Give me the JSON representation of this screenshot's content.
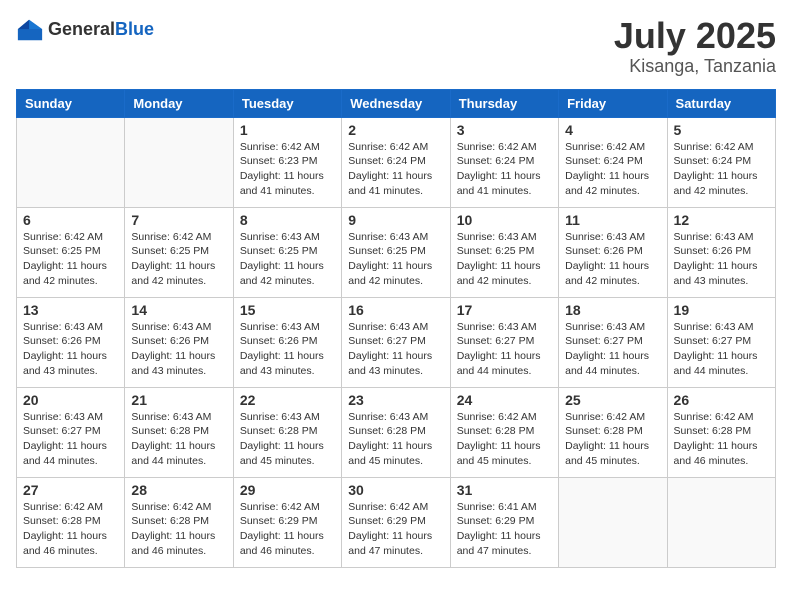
{
  "logo": {
    "general": "General",
    "blue": "Blue"
  },
  "title": {
    "month": "July 2025",
    "location": "Kisanga, Tanzania"
  },
  "weekdays": [
    "Sunday",
    "Monday",
    "Tuesday",
    "Wednesday",
    "Thursday",
    "Friday",
    "Saturday"
  ],
  "weeks": [
    [
      {
        "day": "",
        "sunrise": "",
        "sunset": "",
        "daylight": ""
      },
      {
        "day": "",
        "sunrise": "",
        "sunset": "",
        "daylight": ""
      },
      {
        "day": "1",
        "sunrise": "Sunrise: 6:42 AM",
        "sunset": "Sunset: 6:23 PM",
        "daylight": "Daylight: 11 hours and 41 minutes."
      },
      {
        "day": "2",
        "sunrise": "Sunrise: 6:42 AM",
        "sunset": "Sunset: 6:24 PM",
        "daylight": "Daylight: 11 hours and 41 minutes."
      },
      {
        "day": "3",
        "sunrise": "Sunrise: 6:42 AM",
        "sunset": "Sunset: 6:24 PM",
        "daylight": "Daylight: 11 hours and 41 minutes."
      },
      {
        "day": "4",
        "sunrise": "Sunrise: 6:42 AM",
        "sunset": "Sunset: 6:24 PM",
        "daylight": "Daylight: 11 hours and 42 minutes."
      },
      {
        "day": "5",
        "sunrise": "Sunrise: 6:42 AM",
        "sunset": "Sunset: 6:24 PM",
        "daylight": "Daylight: 11 hours and 42 minutes."
      }
    ],
    [
      {
        "day": "6",
        "sunrise": "Sunrise: 6:42 AM",
        "sunset": "Sunset: 6:25 PM",
        "daylight": "Daylight: 11 hours and 42 minutes."
      },
      {
        "day": "7",
        "sunrise": "Sunrise: 6:42 AM",
        "sunset": "Sunset: 6:25 PM",
        "daylight": "Daylight: 11 hours and 42 minutes."
      },
      {
        "day": "8",
        "sunrise": "Sunrise: 6:43 AM",
        "sunset": "Sunset: 6:25 PM",
        "daylight": "Daylight: 11 hours and 42 minutes."
      },
      {
        "day": "9",
        "sunrise": "Sunrise: 6:43 AM",
        "sunset": "Sunset: 6:25 PM",
        "daylight": "Daylight: 11 hours and 42 minutes."
      },
      {
        "day": "10",
        "sunrise": "Sunrise: 6:43 AM",
        "sunset": "Sunset: 6:25 PM",
        "daylight": "Daylight: 11 hours and 42 minutes."
      },
      {
        "day": "11",
        "sunrise": "Sunrise: 6:43 AM",
        "sunset": "Sunset: 6:26 PM",
        "daylight": "Daylight: 11 hours and 42 minutes."
      },
      {
        "day": "12",
        "sunrise": "Sunrise: 6:43 AM",
        "sunset": "Sunset: 6:26 PM",
        "daylight": "Daylight: 11 hours and 43 minutes."
      }
    ],
    [
      {
        "day": "13",
        "sunrise": "Sunrise: 6:43 AM",
        "sunset": "Sunset: 6:26 PM",
        "daylight": "Daylight: 11 hours and 43 minutes."
      },
      {
        "day": "14",
        "sunrise": "Sunrise: 6:43 AM",
        "sunset": "Sunset: 6:26 PM",
        "daylight": "Daylight: 11 hours and 43 minutes."
      },
      {
        "day": "15",
        "sunrise": "Sunrise: 6:43 AM",
        "sunset": "Sunset: 6:26 PM",
        "daylight": "Daylight: 11 hours and 43 minutes."
      },
      {
        "day": "16",
        "sunrise": "Sunrise: 6:43 AM",
        "sunset": "Sunset: 6:27 PM",
        "daylight": "Daylight: 11 hours and 43 minutes."
      },
      {
        "day": "17",
        "sunrise": "Sunrise: 6:43 AM",
        "sunset": "Sunset: 6:27 PM",
        "daylight": "Daylight: 11 hours and 44 minutes."
      },
      {
        "day": "18",
        "sunrise": "Sunrise: 6:43 AM",
        "sunset": "Sunset: 6:27 PM",
        "daylight": "Daylight: 11 hours and 44 minutes."
      },
      {
        "day": "19",
        "sunrise": "Sunrise: 6:43 AM",
        "sunset": "Sunset: 6:27 PM",
        "daylight": "Daylight: 11 hours and 44 minutes."
      }
    ],
    [
      {
        "day": "20",
        "sunrise": "Sunrise: 6:43 AM",
        "sunset": "Sunset: 6:27 PM",
        "daylight": "Daylight: 11 hours and 44 minutes."
      },
      {
        "day": "21",
        "sunrise": "Sunrise: 6:43 AM",
        "sunset": "Sunset: 6:28 PM",
        "daylight": "Daylight: 11 hours and 44 minutes."
      },
      {
        "day": "22",
        "sunrise": "Sunrise: 6:43 AM",
        "sunset": "Sunset: 6:28 PM",
        "daylight": "Daylight: 11 hours and 45 minutes."
      },
      {
        "day": "23",
        "sunrise": "Sunrise: 6:43 AM",
        "sunset": "Sunset: 6:28 PM",
        "daylight": "Daylight: 11 hours and 45 minutes."
      },
      {
        "day": "24",
        "sunrise": "Sunrise: 6:42 AM",
        "sunset": "Sunset: 6:28 PM",
        "daylight": "Daylight: 11 hours and 45 minutes."
      },
      {
        "day": "25",
        "sunrise": "Sunrise: 6:42 AM",
        "sunset": "Sunset: 6:28 PM",
        "daylight": "Daylight: 11 hours and 45 minutes."
      },
      {
        "day": "26",
        "sunrise": "Sunrise: 6:42 AM",
        "sunset": "Sunset: 6:28 PM",
        "daylight": "Daylight: 11 hours and 46 minutes."
      }
    ],
    [
      {
        "day": "27",
        "sunrise": "Sunrise: 6:42 AM",
        "sunset": "Sunset: 6:28 PM",
        "daylight": "Daylight: 11 hours and 46 minutes."
      },
      {
        "day": "28",
        "sunrise": "Sunrise: 6:42 AM",
        "sunset": "Sunset: 6:28 PM",
        "daylight": "Daylight: 11 hours and 46 minutes."
      },
      {
        "day": "29",
        "sunrise": "Sunrise: 6:42 AM",
        "sunset": "Sunset: 6:29 PM",
        "daylight": "Daylight: 11 hours and 46 minutes."
      },
      {
        "day": "30",
        "sunrise": "Sunrise: 6:42 AM",
        "sunset": "Sunset: 6:29 PM",
        "daylight": "Daylight: 11 hours and 47 minutes."
      },
      {
        "day": "31",
        "sunrise": "Sunrise: 6:41 AM",
        "sunset": "Sunset: 6:29 PM",
        "daylight": "Daylight: 11 hours and 47 minutes."
      },
      {
        "day": "",
        "sunrise": "",
        "sunset": "",
        "daylight": ""
      },
      {
        "day": "",
        "sunrise": "",
        "sunset": "",
        "daylight": ""
      }
    ]
  ]
}
